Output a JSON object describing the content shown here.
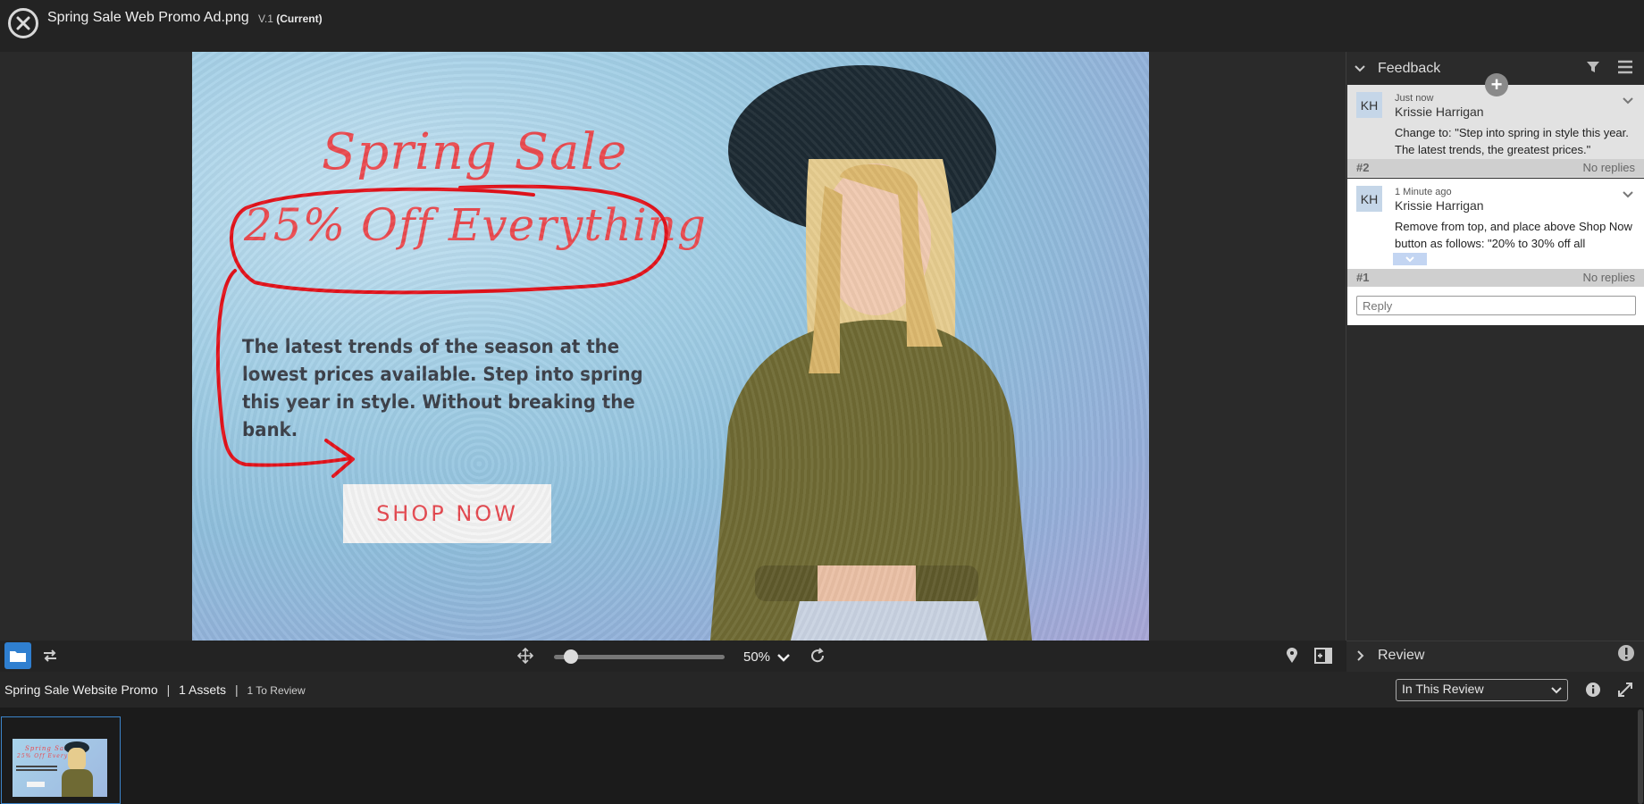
{
  "header": {
    "file_title": "Spring Sale Web Promo Ad.png",
    "version": "V.1",
    "version_status": "(Current)"
  },
  "artwork": {
    "headline": "Spring Sale",
    "subhead": "25% Off Everything",
    "body": "The latest trends of the season at the lowest prices available. Step into spring this year in style. Without breaking the bank.",
    "cta": "SHOP NOW",
    "annotation_color": "#e3121b",
    "accent_color": "#ea4a4f"
  },
  "toolbar": {
    "zoom_value": 0.1,
    "zoom_level": "50%",
    "icons": [
      "folder-icon",
      "swap-icon",
      "fit-screen-icon",
      "refresh-icon",
      "location-pin-icon",
      "panel-toggle-icon"
    ]
  },
  "feedback": {
    "title": "Feedback",
    "comments": [
      {
        "initials": "KH",
        "time": "Just now",
        "author": "Krissie Harrigan",
        "text": "Change to: \"Step into spring in style this year. The latest trends, the greatest prices.\"",
        "number": "#2",
        "replies": "No replies"
      },
      {
        "initials": "KH",
        "time": "1 Minute ago",
        "author": "Krissie Harrigan",
        "text": "Remove from top, and place above Shop Now button as follows: \"20% to 30% off all",
        "number": "#1",
        "replies": "No replies"
      }
    ],
    "reply_placeholder": "Reply"
  },
  "review": {
    "title": "Review"
  },
  "project": {
    "name": "Spring Sale Website Promo",
    "sep": "|",
    "assets": "1 Assets",
    "to_review": "1 To Review",
    "filter_selected": "In This Review"
  },
  "thumbnail": {
    "mini_headline": "Spring Sale",
    "mini_subhead": "25% Off Everything"
  }
}
